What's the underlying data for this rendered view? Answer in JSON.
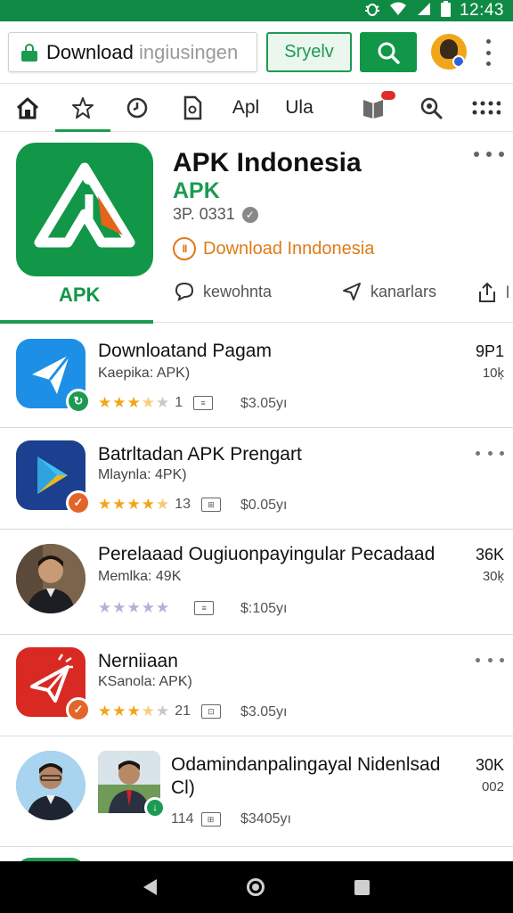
{
  "status_bar": {
    "time": "12:43",
    "icons": [
      "bug-icon",
      "wifi-icon",
      "signal-icon",
      "battery-icon"
    ]
  },
  "top_bar": {
    "search_value": "Download",
    "search_ghost": "ingiusingen",
    "suggest_label": "Sryelv",
    "search_button_icon": "search-icon",
    "menu_icon": "more-vert-icon"
  },
  "nav_tabs": [
    {
      "icon": "home-icon",
      "label": ""
    },
    {
      "icon": "star-icon",
      "label": ""
    },
    {
      "icon": "clock-icon",
      "label": ""
    },
    {
      "icon": "document-icon",
      "label": ""
    },
    {
      "icon": "",
      "label": "Apl"
    },
    {
      "icon": "",
      "label": "Ula"
    },
    {
      "icon": "calendar-icon",
      "label": ""
    },
    {
      "icon": "search-icon",
      "label": ""
    },
    {
      "icon": "grid-icon",
      "label": ""
    }
  ],
  "hero": {
    "icon_label": "APK",
    "title": "APK Indonesia",
    "subtitle": "APK",
    "version": "3P. 0331",
    "download_status": "Download Inndonesia",
    "pause_glyph": "II",
    "actions": [
      {
        "icon": "comment-icon",
        "label": "kewohnta"
      },
      {
        "icon": "send-icon",
        "label": "kanarlars"
      },
      {
        "icon": "share-icon",
        "label": "l"
      }
    ]
  },
  "apps": [
    {
      "title": "Downloatand Pagam",
      "developer": "Kaepika: APK)",
      "stars_filled": 3.5,
      "rating_count": "1",
      "price": "$3.05yı",
      "right_top": "9P1",
      "right_sub": "10ķ",
      "show_more": false,
      "icon_type": "paper-plane-blue",
      "badge": "green"
    },
    {
      "title": "Batrltadan APK Prengart",
      "developer": "Mlaynla: 4PK)",
      "stars_filled": 4.5,
      "rating_count": "13",
      "price": "$0.05yı",
      "right_top": "",
      "right_sub": "",
      "show_more": true,
      "icon_type": "play-store",
      "badge": "orange"
    },
    {
      "title": "Perelaaad Ougiuonpayingular Pecadaad",
      "developer": "Memlka: 49K",
      "stars_filled": 0,
      "rating_count": "",
      "price": "$:105yı",
      "right_top": "36K",
      "right_sub": "30ķ",
      "show_more": false,
      "icon_type": "person-photo",
      "badge": ""
    },
    {
      "title": "Nerniiaan",
      "developer": "KSanola: APK)",
      "stars_filled": 3.5,
      "rating_count": "21",
      "price": "$3.05yı",
      "right_top": "",
      "right_sub": "",
      "show_more": true,
      "icon_type": "paper-plane-red",
      "badge": "orange"
    },
    {
      "title": "Odamindanpalingayal Nidenlsad",
      "title_line2": "Cl)",
      "developer": "",
      "stars_filled": 0,
      "rating_count": "114",
      "price": "$3405yı",
      "right_top": "30K",
      "right_sub": "002",
      "show_more": false,
      "icon_type": "person-photo-2",
      "badge": "green"
    }
  ]
}
